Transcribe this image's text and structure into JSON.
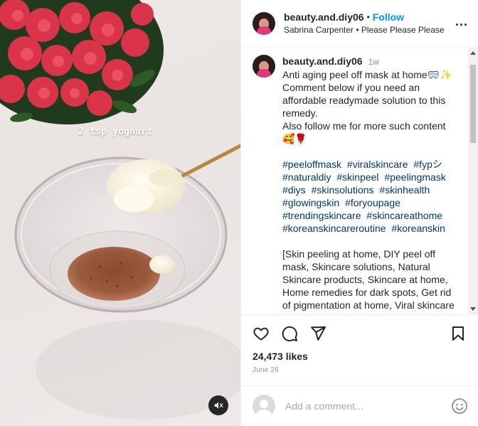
{
  "media": {
    "overlay_text": "2 tsp yoghurt",
    "mute_icon": "speaker-muted-icon"
  },
  "header": {
    "username": "beauty.and.diy06",
    "separator": "•",
    "follow_label": "Follow",
    "audio": "Sabrina Carpenter • Please Please Please",
    "more_icon": "more-horizontal-icon",
    "more_label": "..."
  },
  "caption": {
    "username": "beauty.and.diy06",
    "time": "1w",
    "text": "Anti aging peel off mask at home🥽✨\nComment below if you need an affordable readymade solution to this remedy.\nAlso follow me for more such content 🥰🌹",
    "hashtags": [
      "#peeloffmask",
      "#viralskincare",
      "#fypシ",
      "#naturaldiy",
      "#skinpeel",
      "#peelingmask",
      "#diys",
      "#skinsolutions",
      "#skinhealth",
      "#glowingskin",
      "#foryoupage",
      "#trendingskincare",
      "#skincareathome",
      "#koreanskincareroutine",
      "#koreanskin"
    ],
    "keywords": "[Skin peeling at home, DIY peel off mask, Skincare solutions, Natural Skincare products, Skincare at home, Home remedies for dark spots, Get rid of pigmentation at home, Viral skincare"
  },
  "actions": {
    "like_icon": "heart-icon",
    "comment_icon": "comment-icon",
    "share_icon": "share-icon",
    "save_icon": "bookmark-icon",
    "likes": "24,473 likes",
    "date": "June 26"
  },
  "comment_box": {
    "placeholder": "Add a comment...",
    "emoji_icon": "emoji-icon"
  },
  "colors": {
    "accent": "#0095f6",
    "hashtag": "#00376b",
    "text": "#262626",
    "muted": "#8e8e8e"
  }
}
